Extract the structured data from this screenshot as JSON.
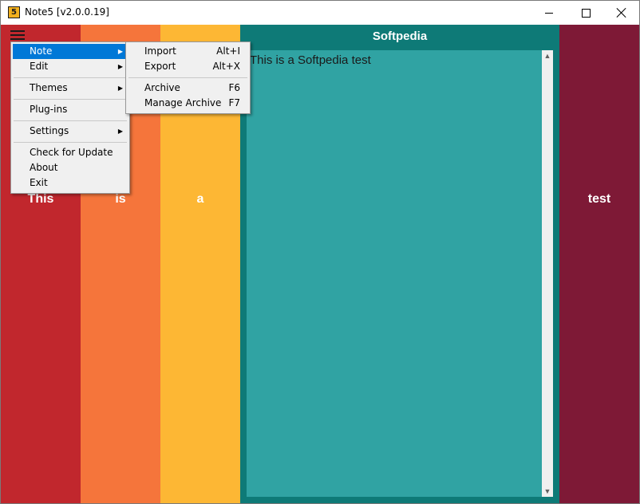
{
  "window": {
    "title": "Note5 [v2.0.0.19]",
    "icon_label": "5"
  },
  "colors": {
    "col1": "#c1272d",
    "col2": "#f5753b",
    "col3": "#fdb734",
    "col4_header": "#0e7a77",
    "col4_body": "#30a3a3",
    "col5": "#7e1936",
    "menu_highlight": "#0078d7"
  },
  "columns": [
    {
      "word": "This"
    },
    {
      "word": "is"
    },
    {
      "word": "a"
    },
    {
      "word": "test"
    }
  ],
  "note": {
    "header": "Softpedia",
    "text": "This is a Softpedia test"
  },
  "main_menu": {
    "items": [
      {
        "label": "Note",
        "submenu": true,
        "highlighted": true
      },
      {
        "label": "Edit",
        "submenu": true
      },
      {
        "label": "Themes",
        "submenu": true
      },
      {
        "label": "Plug-ins"
      },
      {
        "label": "Settings",
        "submenu": true
      },
      {
        "label": "Check for Update"
      },
      {
        "label": "About"
      },
      {
        "label": "Exit"
      }
    ]
  },
  "note_submenu": {
    "items": [
      {
        "label": "Import",
        "shortcut": "Alt+I"
      },
      {
        "label": "Export",
        "shortcut": "Alt+X"
      },
      {
        "label": "Archive",
        "shortcut": "F6"
      },
      {
        "label": "Manage Archive",
        "shortcut": "F7"
      }
    ]
  },
  "icons": {
    "menu": "hamburger-icon",
    "submenu_arrow": "triangle-right-icon",
    "scroll_up": "scroll-up-arrow",
    "scroll_down": "scroll-down-arrow"
  }
}
